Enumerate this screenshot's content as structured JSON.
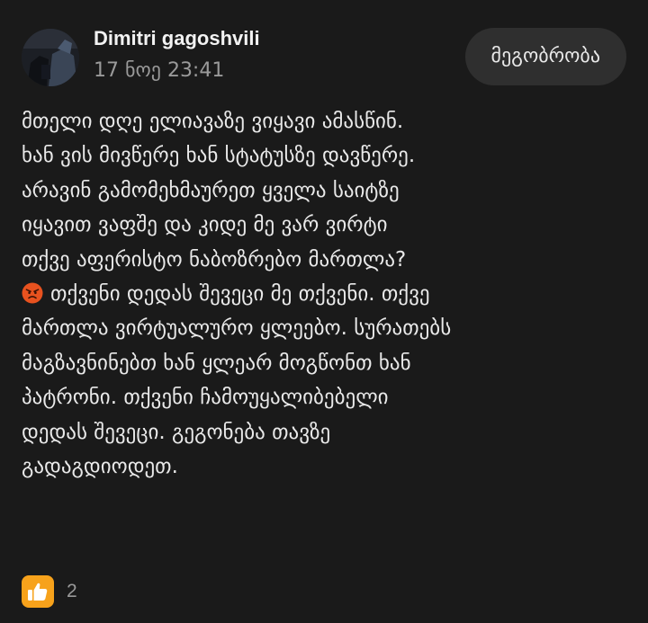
{
  "post": {
    "author": "Dimitri gagoshvili",
    "timestamp": "17 ნოე 23:41",
    "friend_button_label": "მეგობრობა",
    "lines": [
      "მთელი დღე ელიავაზე ვიყავი ამასწინ.",
      "ხან ვის მივწერე ხან სტატუსზე დავწერე.",
      "არავინ გამომეხმაურეთ ყველა საიტზე",
      "იყავით ვაფშე და კიდე მე ვარ ვირტი",
      "თქვე აფერისტო ნაბოზრებო მართლა?"
    ],
    "angry_emoji": "angry-face-icon",
    "lines_after_emoji": [
      "თქვენი დედას შევეცი მე თქვენი. თქვე",
      "მართლა ვირტუალურო ყლეებო. სურათებს",
      "მაგზავნინებთ ხან ყლეარ მოგწონთ ხან",
      "პატრონი. თქვენი ჩამოუყალიბებელი",
      "დედას შევეცი. გეგონება თავზე",
      "გადაგდიოდეთ."
    ]
  },
  "reactions": {
    "icon": "like-icon",
    "count": "2"
  },
  "colors": {
    "background": "#1a1a1a",
    "text": "#e9e9e9",
    "muted": "#9a9a9a",
    "button_bg": "#2f2f2f",
    "like_orange": "#f7a21b",
    "angry_red": "#e8521f"
  }
}
